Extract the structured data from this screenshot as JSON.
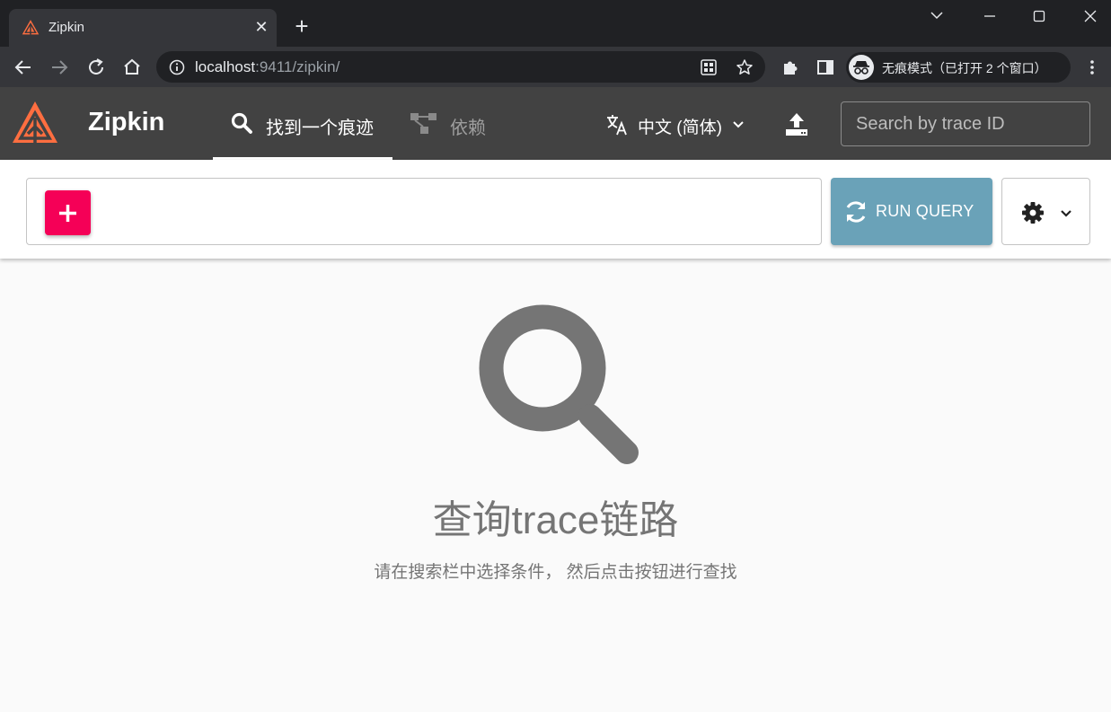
{
  "browser": {
    "tab": {
      "title": "Zipkin",
      "close_glyph": "✕"
    },
    "new_tab_glyph": "+",
    "url": {
      "host": "localhost",
      "rest": ":9411/zipkin/"
    },
    "incognito_label": "无痕模式（已打开 2 个窗口）"
  },
  "app": {
    "title": "Zipkin",
    "brand_color": "#ff6e40",
    "nav": [
      {
        "label": "找到一个痕迹",
        "icon": "search-icon",
        "active": true
      },
      {
        "label": "依赖",
        "icon": "dependency-icon",
        "active": false
      }
    ],
    "language": {
      "label": "中文 (简体)",
      "icon": "translate-icon"
    },
    "trace_search": {
      "placeholder": "Search by trace ID"
    }
  },
  "query": {
    "add_color": "#f50057",
    "run_label": "RUN QUERY",
    "run_color": "#6aa2b8"
  },
  "empty_state": {
    "title": "查询trace链路",
    "subtitle": "请在搜索栏中选择条件， 然后点击按钮进行查找"
  }
}
